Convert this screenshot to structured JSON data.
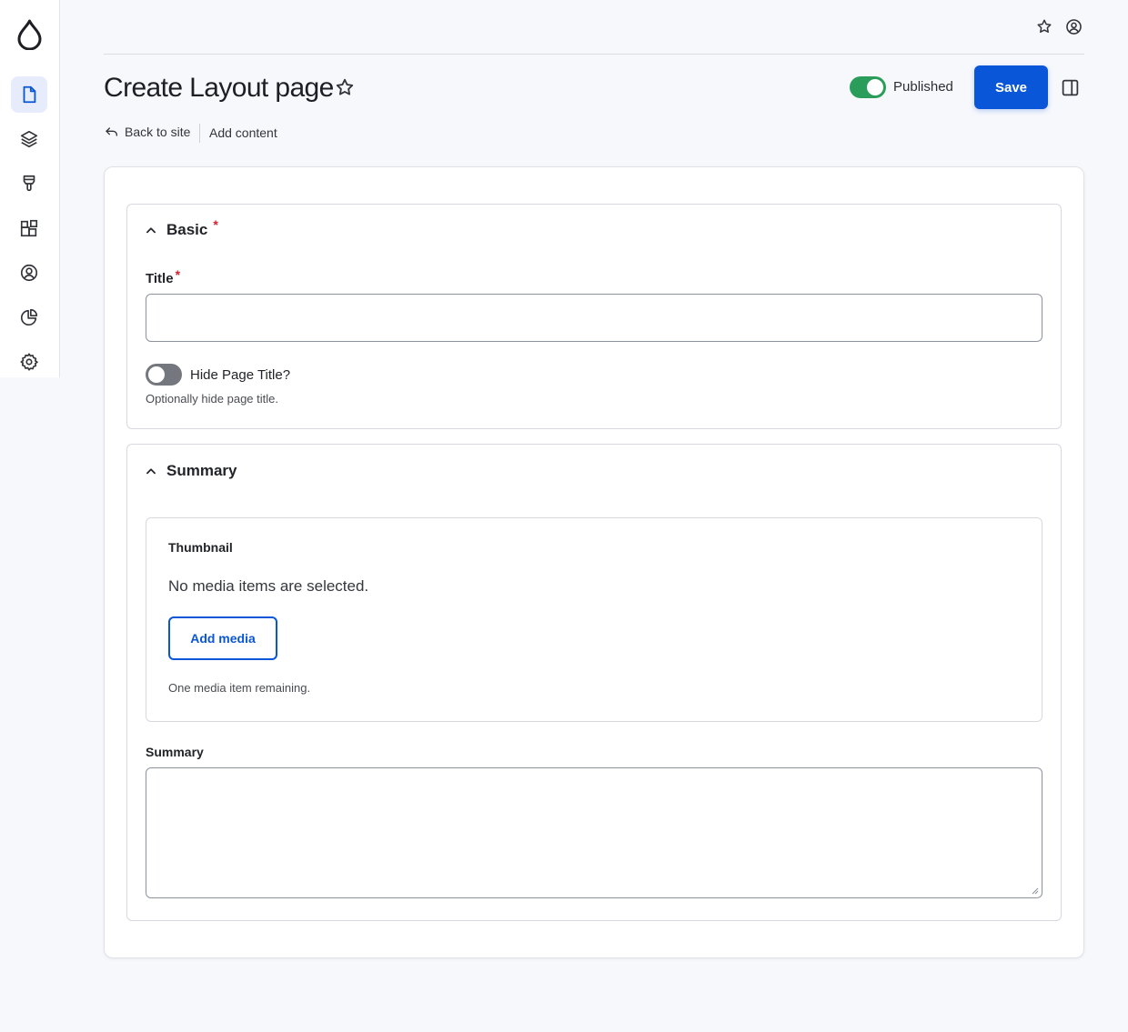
{
  "colors": {
    "accent": "#0a56d8",
    "published_toggle": "#2a9d5b",
    "required": "#d6202f",
    "sidebar_active_bg": "#e6ecfc"
  },
  "sidebar": {
    "logo_icon": "drupal-drop-icon",
    "items": [
      {
        "icon": "content-page-icon",
        "active": true
      },
      {
        "icon": "layers-icon",
        "active": false
      },
      {
        "icon": "paintbrush-icon",
        "active": false
      },
      {
        "icon": "blocks-icon",
        "active": false
      },
      {
        "icon": "user-circle-icon",
        "active": false
      },
      {
        "icon": "pie-chart-icon",
        "active": false
      },
      {
        "icon": "gear-icon",
        "active": false
      }
    ]
  },
  "topbar": {
    "icons": [
      "star-icon",
      "account-icon"
    ]
  },
  "header": {
    "title": "Create Layout page",
    "published_label": "Published",
    "published_on": true,
    "save_label": "Save"
  },
  "breadcrumb": {
    "back_label": "Back to site",
    "add_content_label": "Add content"
  },
  "basic": {
    "heading": "Basic",
    "required_mark": "*",
    "title_label": "Title",
    "title_value": "",
    "hide_title_label": "Hide Page Title?",
    "hide_title_on": false,
    "hide_title_help": "Optionally hide page title."
  },
  "summary_section": {
    "heading": "Summary",
    "thumbnail_label": "Thumbnail",
    "no_media_text": "No media items are selected.",
    "add_media_label": "Add media",
    "remaining_text": "One media item remaining.",
    "summary_label": "Summary",
    "summary_value": ""
  }
}
